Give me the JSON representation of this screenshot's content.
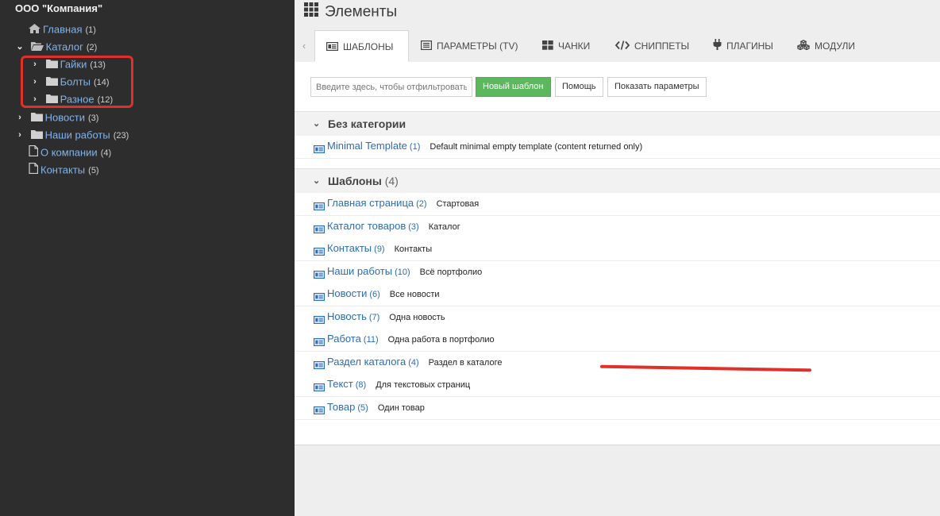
{
  "site_title": "ООО \"Компания\"",
  "tree": {
    "home": {
      "label": "Главная",
      "count": "(1)"
    },
    "catalog": {
      "label": "Каталог",
      "count": "(2)"
    },
    "nuts": {
      "label": "Гайки",
      "count": "(13)"
    },
    "bolts": {
      "label": "Болты",
      "count": "(14)"
    },
    "misc": {
      "label": "Разное",
      "count": "(12)"
    },
    "news": {
      "label": "Новости",
      "count": "(3)"
    },
    "works": {
      "label": "Наши работы",
      "count": "(23)"
    },
    "about": {
      "label": "О компании",
      "count": "(4)"
    },
    "contacts": {
      "label": "Контакты",
      "count": "(5)"
    }
  },
  "page_title": "Элементы",
  "tabs": {
    "templates": "ШАБЛОНЫ",
    "tvs": "ПАРАМЕТРЫ (TV)",
    "chunks": "ЧАНКИ",
    "snippets": "СНИППЕТЫ",
    "plugins": "ПЛАГИНЫ",
    "modules": "МОДУЛИ"
  },
  "toolbar": {
    "filter_placeholder": "Введите здесь, чтобы отфильтровать",
    "new_template": "Новый шаблон",
    "help": "Помощь",
    "show_params": "Показать параметры"
  },
  "groups": {
    "uncategorized": {
      "title": "Без категории",
      "count": "",
      "items": [
        {
          "name": "Minimal Template",
          "id": "(1)",
          "desc": "Default minimal empty template (content returned only)"
        }
      ]
    },
    "templates": {
      "title": "Шаблоны",
      "count": "(4)",
      "items": [
        {
          "name": "Главная страница",
          "id": "(2)",
          "desc": "Стартовая"
        },
        {
          "name": "Каталог товаров",
          "id": "(3)",
          "desc": "Каталог"
        },
        {
          "name": "Контакты",
          "id": "(9)",
          "desc": "Контакты"
        },
        {
          "name": "Наши работы",
          "id": "(10)",
          "desc": "Всё портфолио"
        },
        {
          "name": "Новости",
          "id": "(6)",
          "desc": "Все новости"
        },
        {
          "name": "Новость",
          "id": "(7)",
          "desc": "Одна новость"
        },
        {
          "name": "Работа",
          "id": "(11)",
          "desc": "Одна работа в портфолио"
        },
        {
          "name": "Раздел каталога",
          "id": "(4)",
          "desc": "Раздел в каталоге"
        },
        {
          "name": "Текст",
          "id": "(8)",
          "desc": "Для текстовых страниц"
        },
        {
          "name": "Товар",
          "id": "(5)",
          "desc": "Один товар"
        }
      ]
    }
  },
  "colors": {
    "sidebar_bg": "#2d2d2d",
    "link": "#2a6db8",
    "primary_button": "#5cb85c",
    "annotation": "#e0302a"
  }
}
